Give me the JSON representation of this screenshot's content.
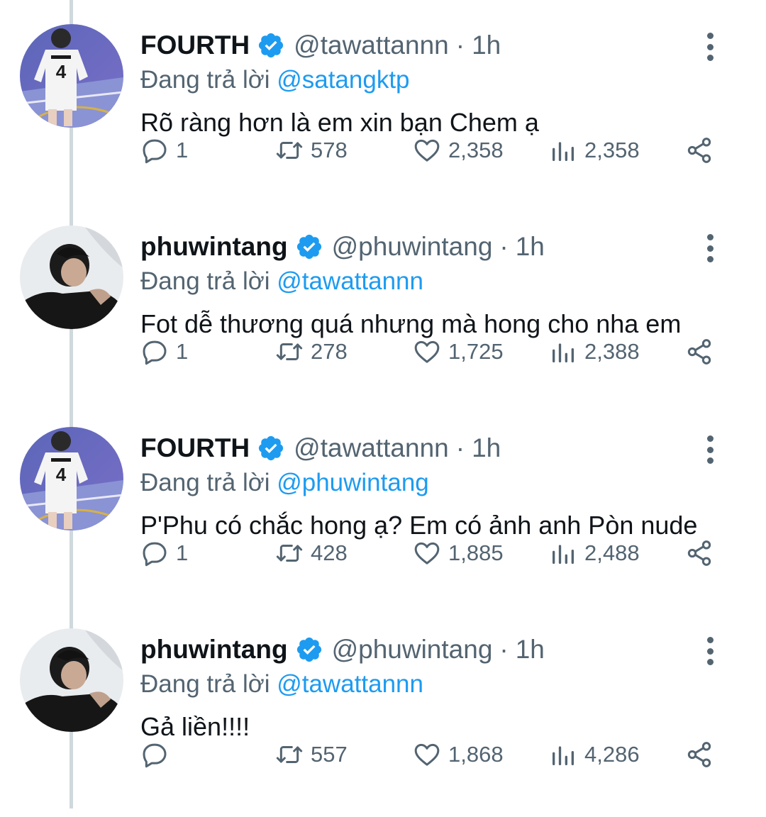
{
  "colors": {
    "accent": "#1d9bf0",
    "muted": "#536471",
    "text": "#0f1419",
    "thread_line": "#cfd9de"
  },
  "tweets": [
    {
      "name": "FOURTH",
      "handle": "@tawattannn",
      "separator": "·",
      "time": "1h",
      "reply_prefix": "Đang trả lời",
      "reply_to": "@satangktp",
      "text": "Rõ ràng hơn là em xin bạn Chem ạ",
      "replies": "1",
      "retweets": "578",
      "likes": "2,358",
      "views": "2,358",
      "avatar": "jersey"
    },
    {
      "name": "phuwintang",
      "handle": "@phuwintang",
      "separator": "·",
      "time": "1h",
      "reply_prefix": "Đang trả lời",
      "reply_to": "@tawattannn",
      "text": "Fot dễ thương quá nhưng mà hong cho nha em",
      "replies": "1",
      "retweets": "278",
      "likes": "1,725",
      "views": "2,388",
      "avatar": "portrait"
    },
    {
      "name": "FOURTH",
      "handle": "@tawattannn",
      "separator": "·",
      "time": "1h",
      "reply_prefix": "Đang trả lời",
      "reply_to": "@phuwintang",
      "text": "P'Phu có chắc hong ạ? Em có ảnh anh Pòn nude",
      "replies": "1",
      "retweets": "428",
      "likes": "1,885",
      "views": "2,488",
      "avatar": "jersey"
    },
    {
      "name": "phuwintang",
      "handle": "@phuwintang",
      "separator": "·",
      "time": "1h",
      "reply_prefix": "Đang trả lời",
      "reply_to": "@tawattannn",
      "text": "Gả liền!!!!",
      "replies": "",
      "retweets": "557",
      "likes": "1,868",
      "views": "4,286",
      "avatar": "portrait"
    }
  ]
}
